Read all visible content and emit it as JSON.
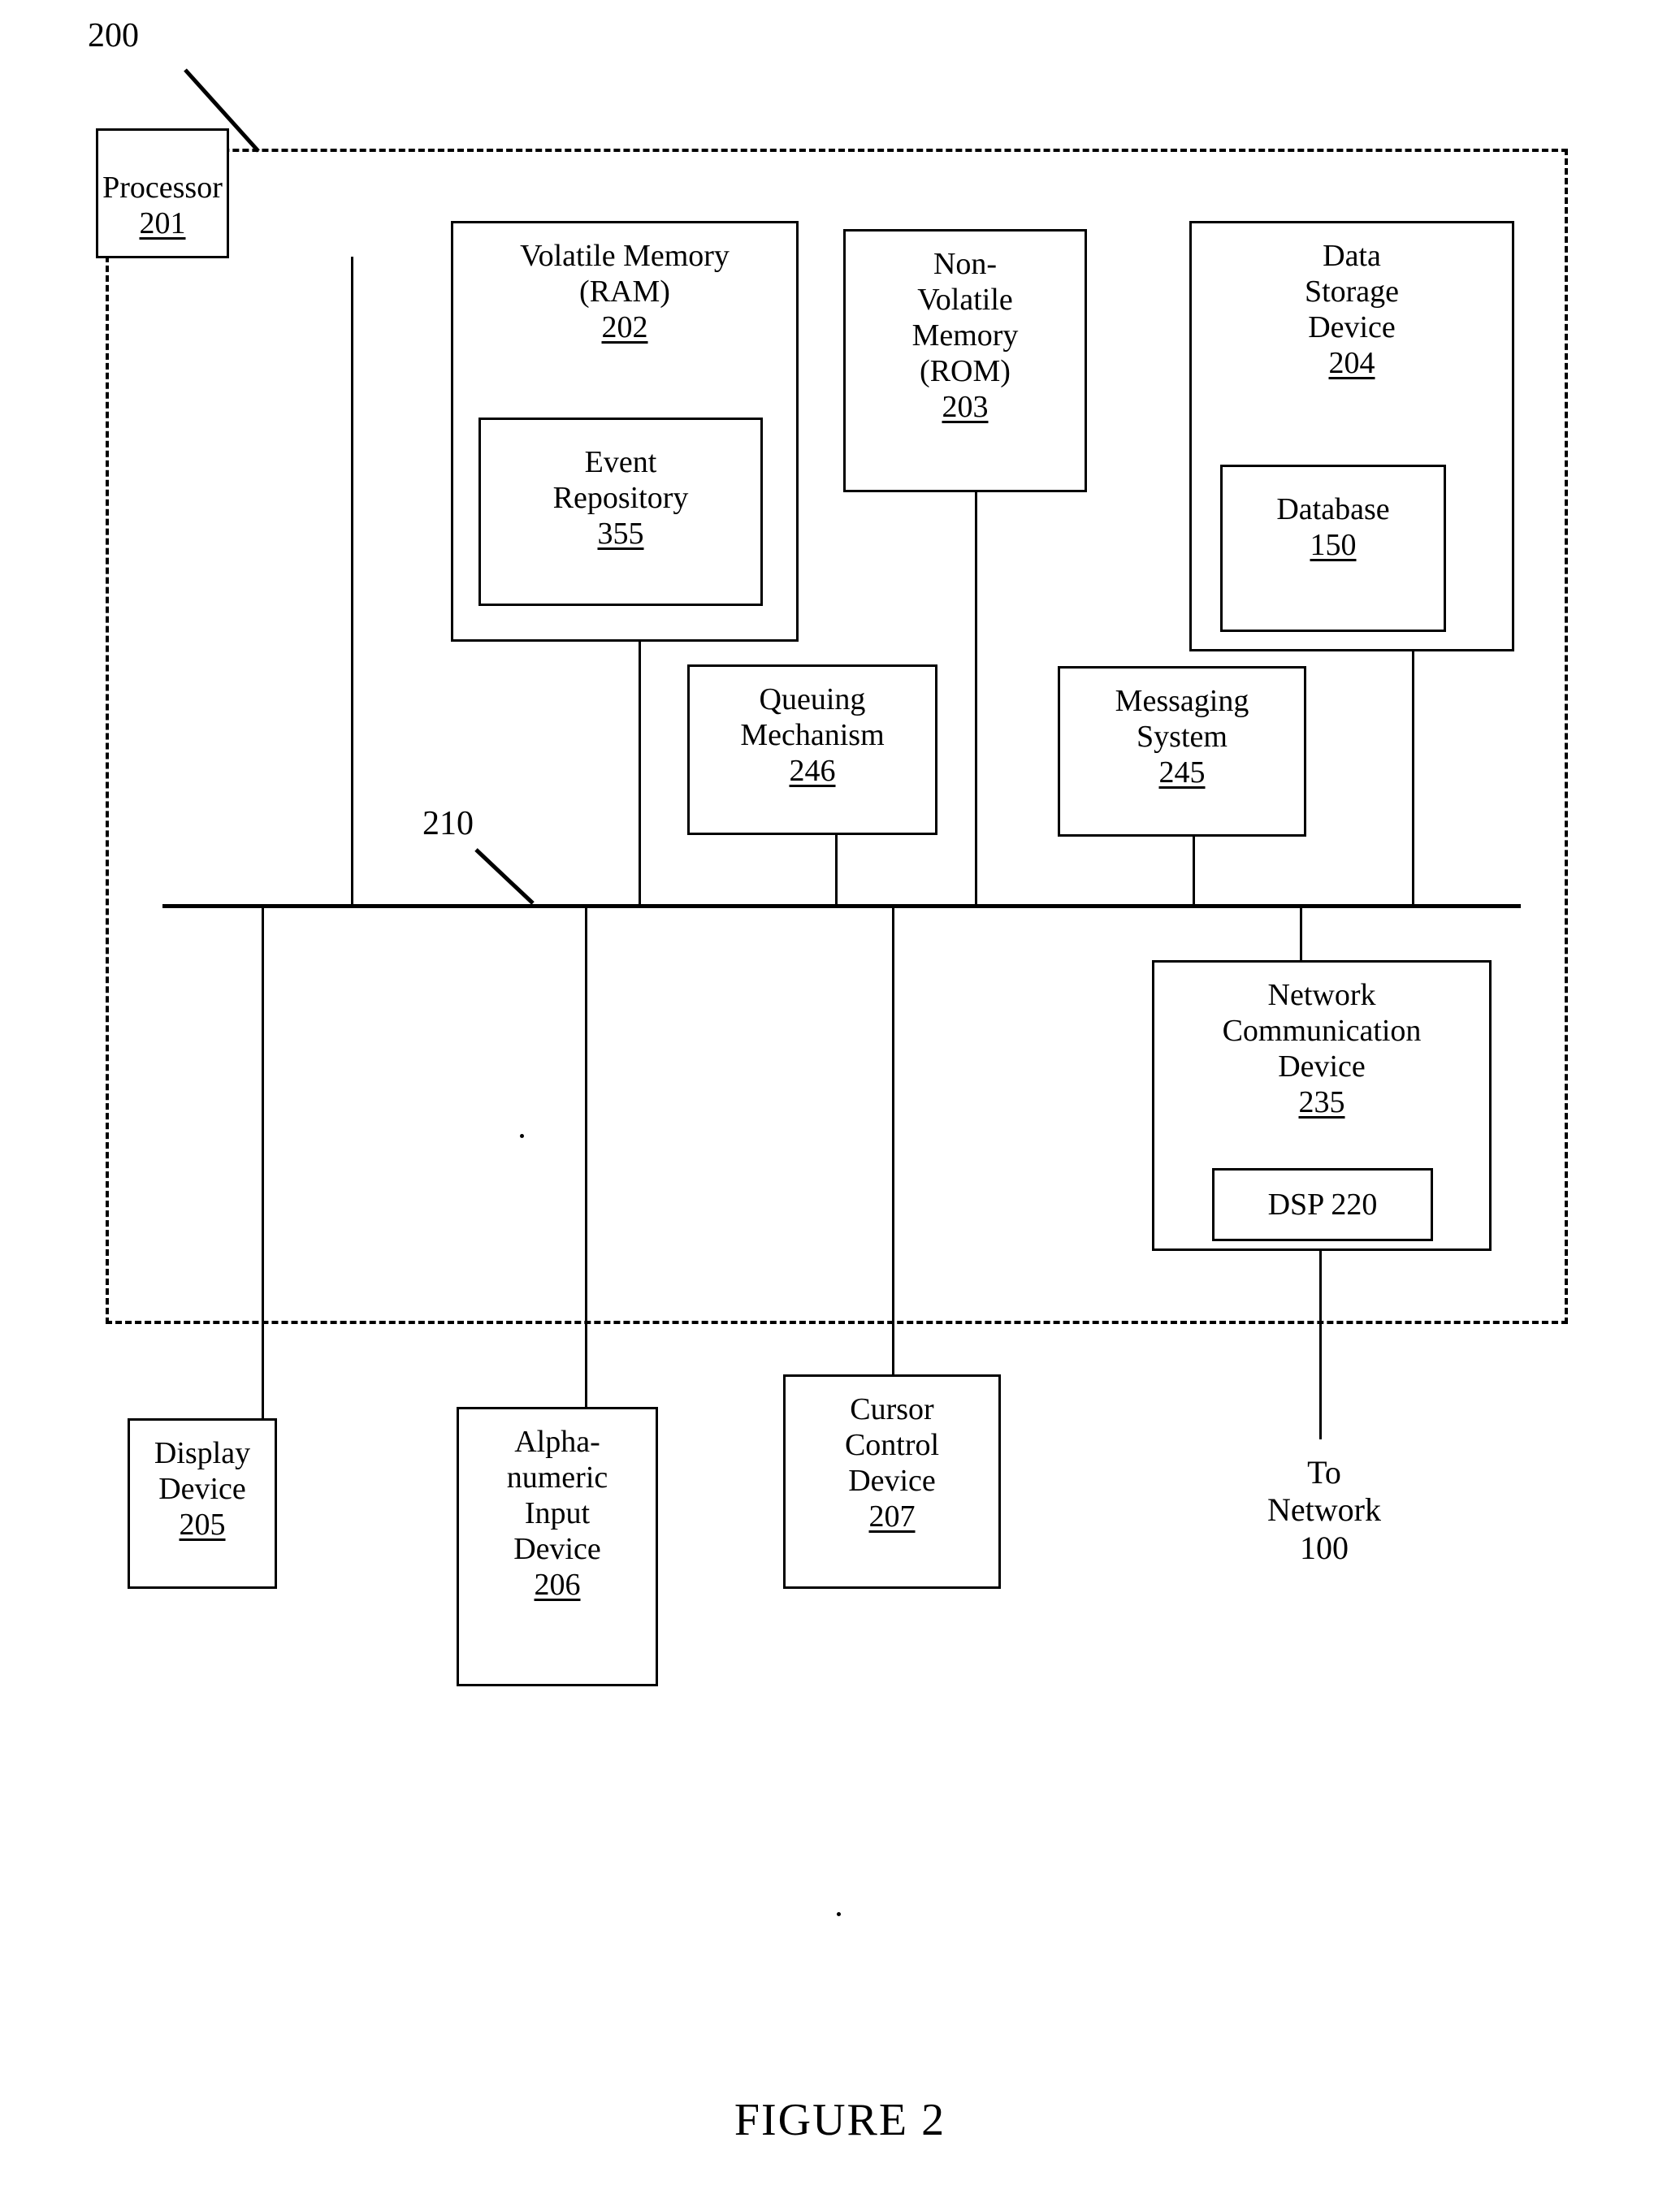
{
  "figure": {
    "caption": "FIGURE 2",
    "system_ref": "200",
    "bus_ref": "210"
  },
  "boxes": {
    "processor": {
      "label": "Processor",
      "number": "201"
    },
    "volatile_memory": {
      "label": "Volatile Memory\n(RAM)",
      "number": "202"
    },
    "event_repository": {
      "label": "Event\nRepository",
      "number": "355"
    },
    "nonvolatile_memory": {
      "label": "Non-\nVolatile\nMemory\n(ROM)",
      "number": "203"
    },
    "data_storage": {
      "label": "Data\nStorage\nDevice",
      "number": "204"
    },
    "database": {
      "label": "Database",
      "number": "150"
    },
    "queuing": {
      "label": "Queuing\nMechanism",
      "number": "246"
    },
    "messaging": {
      "label": "Messaging\nSystem",
      "number": "245"
    },
    "network_device": {
      "label": "Network\nCommunication\nDevice",
      "number": "235"
    },
    "dsp": {
      "label": "DSP 220",
      "number": ""
    },
    "display": {
      "label": "Display\nDevice",
      "number": "205"
    },
    "alphanumeric": {
      "label": "Alpha-\nnumeric\nInput\nDevice",
      "number": "206"
    },
    "cursor": {
      "label": "Cursor\nControl\nDevice",
      "number": "207"
    }
  },
  "annotations": {
    "to_network": "To\nNetwork\n100"
  },
  "colors": {
    "ink": "#000000",
    "paper": "#ffffff"
  }
}
